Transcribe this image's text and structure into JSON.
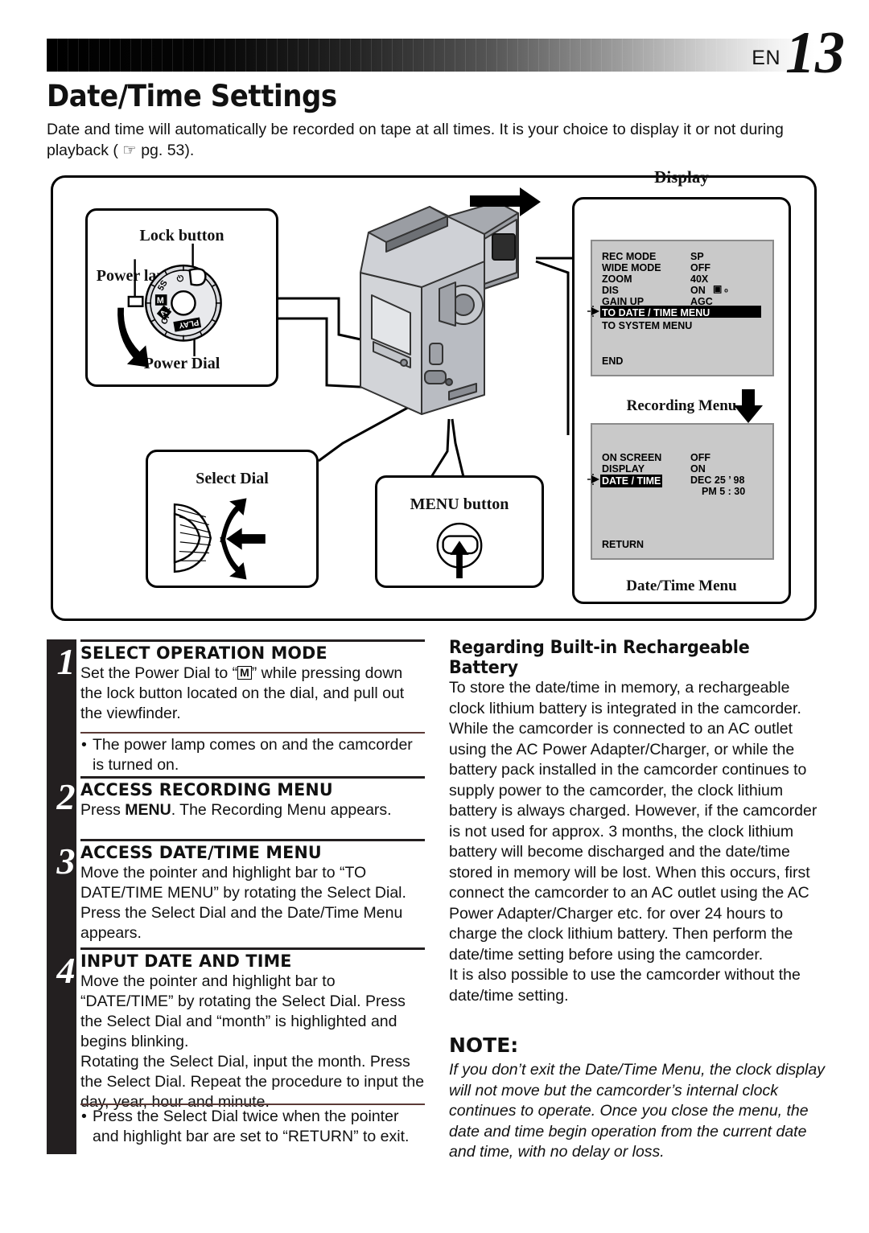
{
  "header": {
    "lang_code": "EN",
    "page_number": "13"
  },
  "title": "Date/Time Settings",
  "intro": "Date and time will automatically be recorded on tape at all times. It is your choice to display it or not during playback ( ☞ pg. 53).",
  "diagram": {
    "labels": {
      "lock_button": "Lock button",
      "power_lamp": "Power lamp",
      "power_dial": "Power Dial",
      "select_dial": "Select Dial",
      "menu_button": "MENU button",
      "display": "Display",
      "recording_menu": "Recording Menu",
      "date_time_menu": "Date/Time Menu"
    },
    "power_dial_positions": [
      "⏻",
      "5S",
      "M",
      "A",
      "OFF",
      "PLAY"
    ],
    "recording_menu": {
      "rows": [
        {
          "label": "REC MODE",
          "value": "SP",
          "highlight": false
        },
        {
          "label": "WIDE MODE",
          "value": "OFF",
          "highlight": false
        },
        {
          "label": "ZOOM",
          "value": "40X",
          "highlight": false
        },
        {
          "label": "DIS",
          "value": "ON",
          "highlight": false,
          "icon": "hand-shake-icon"
        },
        {
          "label": "GAIN UP",
          "value": "AGC",
          "highlight": false
        },
        {
          "label": "TO DATE / TIME MENU",
          "value": "",
          "highlight": true,
          "pointer": true
        },
        {
          "label": "TO SYSTEM MENU",
          "value": "",
          "highlight": false
        }
      ],
      "footer": "END"
    },
    "date_time_menu": {
      "rows": [
        {
          "label": "ON SCREEN",
          "value": "OFF",
          "highlight": false
        },
        {
          "label": "DISPLAY",
          "value": "ON",
          "highlight": false
        },
        {
          "label": "DATE / TIME",
          "value": "DEC 25 ’ 98",
          "value2": "PM   5 : 30",
          "highlight": true,
          "pointer": true
        }
      ],
      "footer": "RETURN"
    }
  },
  "steps": [
    {
      "number": "1",
      "heading": "SELECT OPERATION MODE",
      "body_pre": "Set the Power Dial to “",
      "body_box": "M",
      "body_post": "” while pressing down the lock button located on the dial, and pull out the viewfinder.",
      "bullet": "The power lamp comes on and the camcorder is turned on."
    },
    {
      "number": "2",
      "heading": "ACCESS RECORDING MENU",
      "body_pre": "Press ",
      "body_strong": "MENU",
      "body_post": ". The Recording Menu appears."
    },
    {
      "number": "3",
      "heading": "ACCESS DATE/TIME MENU",
      "body": "Move the pointer and highlight bar to “TO DATE/TIME MENU” by rotating the Select Dial. Press the Select Dial and the Date/Time Menu appears."
    },
    {
      "number": "4",
      "heading": "INPUT DATE AND TIME",
      "body": "Move the pointer and highlight bar to “DATE/TIME” by rotating the Select Dial. Press the Select Dial and “month” is highlighted and begins blinking.\nRotating the Select Dial, input the month. Press the Select Dial. Repeat the procedure to input the day, year, hour and minute.",
      "bullet": "Press the Select Dial twice when the pointer and highlight bar are set to “RETURN” to exit."
    }
  ],
  "battery": {
    "heading": "Regarding Built-in Rechargeable Battery",
    "paragraph1": "To store the date/time in memory, a rechargeable clock lithium battery is integrated in the camcorder. While the camcorder is connected to an AC outlet using the AC Power Adapter/Charger, or while the battery pack installed in the camcorder continues to supply power to the camcorder, the clock lithium battery is always charged. However, if the camcorder is not used for approx. 3 months, the clock lithium battery will become discharged and the date/time stored in memory will be lost. When this occurs, first connect the camcorder to an AC outlet using the AC Power Adapter/Charger etc. for over 24 hours to charge the clock lithium battery. Then perform the date/time setting before using the camcorder.",
    "paragraph2": "It is also possible to use the camcorder without the date/time setting."
  },
  "note": {
    "heading": "NOTE:",
    "body": "If you don’t exit the Date/Time Menu, the clock display will not move but the camcorder’s internal clock continues to operate. Once you close the menu, the date and time begin operation from the current date and time, with no delay or loss."
  }
}
